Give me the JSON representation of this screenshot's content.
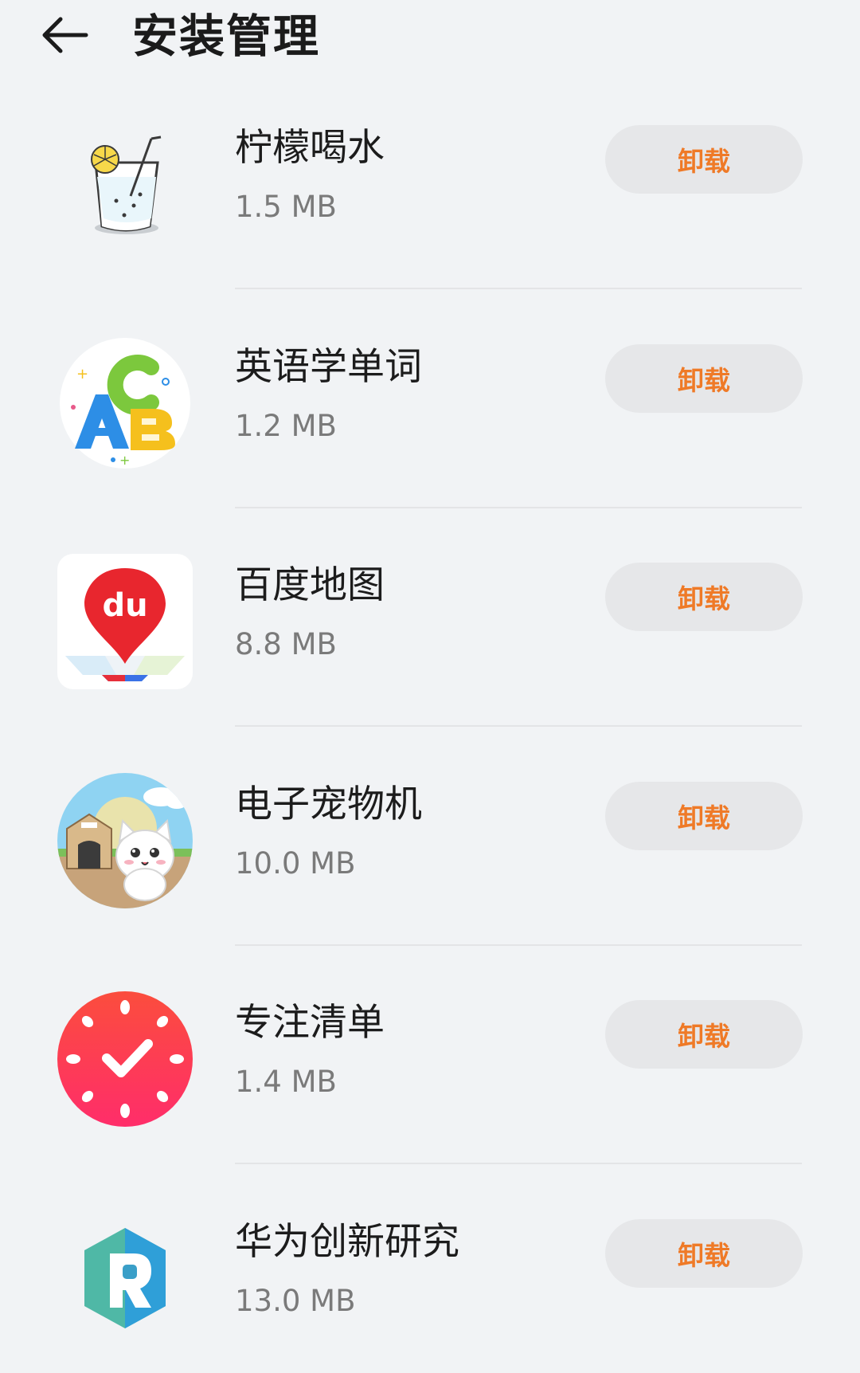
{
  "header": {
    "back_icon": "arrow-left-icon",
    "title": "安装管理"
  },
  "apps": [
    {
      "name": "柠檬喝水",
      "size": "1.5 MB",
      "uninstall_label": "卸载",
      "icon": "lemon-water-icon"
    },
    {
      "name": "英语学单词",
      "size": "1.2 MB",
      "uninstall_label": "卸载",
      "icon": "abc-letters-icon"
    },
    {
      "name": "百度地图",
      "size": "8.8 MB",
      "uninstall_label": "卸载",
      "icon": "baidu-map-pin-icon"
    },
    {
      "name": "电子宠物机",
      "size": "10.0 MB",
      "uninstall_label": "卸载",
      "icon": "cat-pet-icon"
    },
    {
      "name": "专注清单",
      "size": "1.4 MB",
      "uninstall_label": "卸载",
      "icon": "focus-clock-check-icon"
    },
    {
      "name": "华为创新研究",
      "size": "13.0 MB",
      "uninstall_label": "卸载",
      "icon": "huawei-research-r-icon"
    }
  ],
  "colors": {
    "background": "#f1f3f5",
    "uninstall_text": "#ef7a27",
    "button_bg": "#e6e7e9",
    "title_text": "#1b1b1b",
    "size_text": "#7a7a7a"
  }
}
